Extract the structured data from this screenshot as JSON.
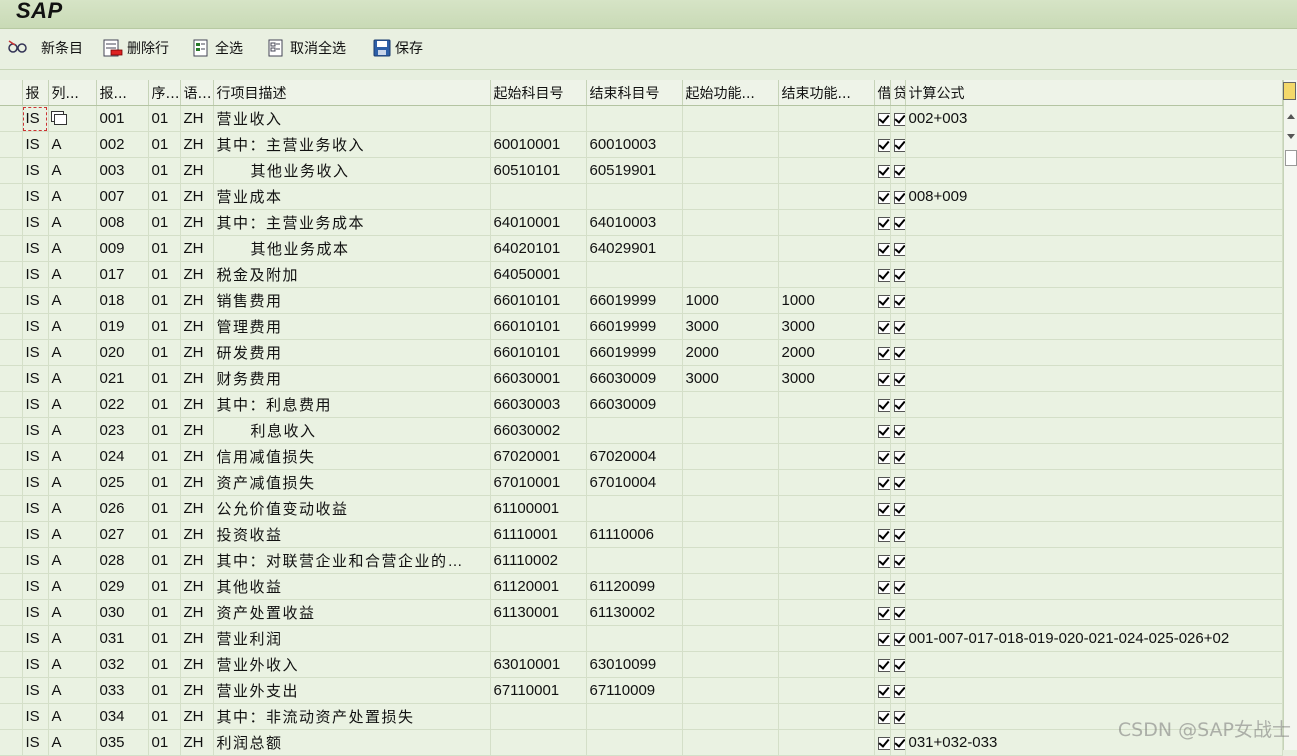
{
  "app": {
    "title": "SAP"
  },
  "toolbar": {
    "new_entry": "新条目",
    "delete_row": "删除行",
    "select_all": "全选",
    "deselect_all": "取消全选",
    "save": "保存"
  },
  "columns": [
    "报",
    "列...",
    "报...",
    "序...",
    "语...",
    "行项目描述",
    "起始科目号",
    "结束科目号",
    "起始功能...",
    "结束功能...",
    "借",
    "贷",
    "计算公式"
  ],
  "rows": [
    [
      "IS",
      "",
      "001",
      "01",
      "ZH",
      "营业收入",
      "",
      "",
      "",
      "",
      true,
      true,
      "002+003"
    ],
    [
      "IS",
      "A",
      "002",
      "01",
      "ZH",
      "其中：主营业务收入",
      "60010001",
      "60010003",
      "",
      "",
      true,
      true,
      ""
    ],
    [
      "IS",
      "A",
      "003",
      "01",
      "ZH",
      "      其他业务收入",
      "60510101",
      "60519901",
      "",
      "",
      true,
      true,
      ""
    ],
    [
      "IS",
      "A",
      "007",
      "01",
      "ZH",
      "营业成本",
      "",
      "",
      "",
      "",
      true,
      true,
      "008+009"
    ],
    [
      "IS",
      "A",
      "008",
      "01",
      "ZH",
      "其中：主营业务成本",
      "64010001",
      "64010003",
      "",
      "",
      true,
      true,
      ""
    ],
    [
      "IS",
      "A",
      "009",
      "01",
      "ZH",
      "      其他业务成本",
      "64020101",
      "64029901",
      "",
      "",
      true,
      true,
      ""
    ],
    [
      "IS",
      "A",
      "017",
      "01",
      "ZH",
      "税金及附加",
      "64050001",
      "",
      "",
      "",
      true,
      true,
      ""
    ],
    [
      "IS",
      "A",
      "018",
      "01",
      "ZH",
      "销售费用",
      "66010101",
      "66019999",
      "1000",
      "1000",
      true,
      true,
      ""
    ],
    [
      "IS",
      "A",
      "019",
      "01",
      "ZH",
      "管理费用",
      "66010101",
      "66019999",
      "3000",
      "3000",
      true,
      true,
      ""
    ],
    [
      "IS",
      "A",
      "020",
      "01",
      "ZH",
      "研发费用",
      "66010101",
      "66019999",
      "2000",
      "2000",
      true,
      true,
      ""
    ],
    [
      "IS",
      "A",
      "021",
      "01",
      "ZH",
      "财务费用",
      "66030001",
      "66030009",
      "3000",
      "3000",
      true,
      true,
      ""
    ],
    [
      "IS",
      "A",
      "022",
      "01",
      "ZH",
      "其中：利息费用",
      "66030003",
      "66030009",
      "",
      "",
      true,
      true,
      ""
    ],
    [
      "IS",
      "A",
      "023",
      "01",
      "ZH",
      "      利息收入",
      "66030002",
      "",
      "",
      "",
      true,
      true,
      ""
    ],
    [
      "IS",
      "A",
      "024",
      "01",
      "ZH",
      "信用减值损失",
      "67020001",
      "67020004",
      "",
      "",
      true,
      true,
      ""
    ],
    [
      "IS",
      "A",
      "025",
      "01",
      "ZH",
      "资产减值损失",
      "67010001",
      "67010004",
      "",
      "",
      true,
      true,
      ""
    ],
    [
      "IS",
      "A",
      "026",
      "01",
      "ZH",
      "公允价值变动收益",
      "61100001",
      "",
      "",
      "",
      true,
      true,
      ""
    ],
    [
      "IS",
      "A",
      "027",
      "01",
      "ZH",
      "投资收益",
      "61110001",
      "61110006",
      "",
      "",
      true,
      true,
      ""
    ],
    [
      "IS",
      "A",
      "028",
      "01",
      "ZH",
      "其中：对联营企业和合营企业的…",
      "61110002",
      "",
      "",
      "",
      true,
      true,
      ""
    ],
    [
      "IS",
      "A",
      "029",
      "01",
      "ZH",
      "其他收益",
      "61120001",
      "61120099",
      "",
      "",
      true,
      true,
      ""
    ],
    [
      "IS",
      "A",
      "030",
      "01",
      "ZH",
      "资产处置收益",
      "61130001",
      "61130002",
      "",
      "",
      true,
      true,
      ""
    ],
    [
      "IS",
      "A",
      "031",
      "01",
      "ZH",
      "营业利润",
      "",
      "",
      "",
      "",
      true,
      true,
      "001-007-017-018-019-020-021-024-025-026+02"
    ],
    [
      "IS",
      "A",
      "032",
      "01",
      "ZH",
      "营业外收入",
      "63010001",
      "63010099",
      "",
      "",
      true,
      true,
      ""
    ],
    [
      "IS",
      "A",
      "033",
      "01",
      "ZH",
      "营业外支出",
      "67110001",
      "67110009",
      "",
      "",
      true,
      true,
      ""
    ],
    [
      "IS",
      "A",
      "034",
      "01",
      "ZH",
      "其中：非流动资产处置损失",
      "",
      "",
      "",
      "",
      true,
      true,
      ""
    ],
    [
      "IS",
      "A",
      "035",
      "01",
      "ZH",
      "利润总额",
      "",
      "",
      "",
      "",
      true,
      true,
      "031+032-033"
    ]
  ],
  "watermark": "CSDN @SAP女战士",
  "colors": {
    "title_bar": "#c9dab6",
    "grid_bg": "#eaf2e2",
    "toolbar_bg": "#e9f0e1"
  }
}
